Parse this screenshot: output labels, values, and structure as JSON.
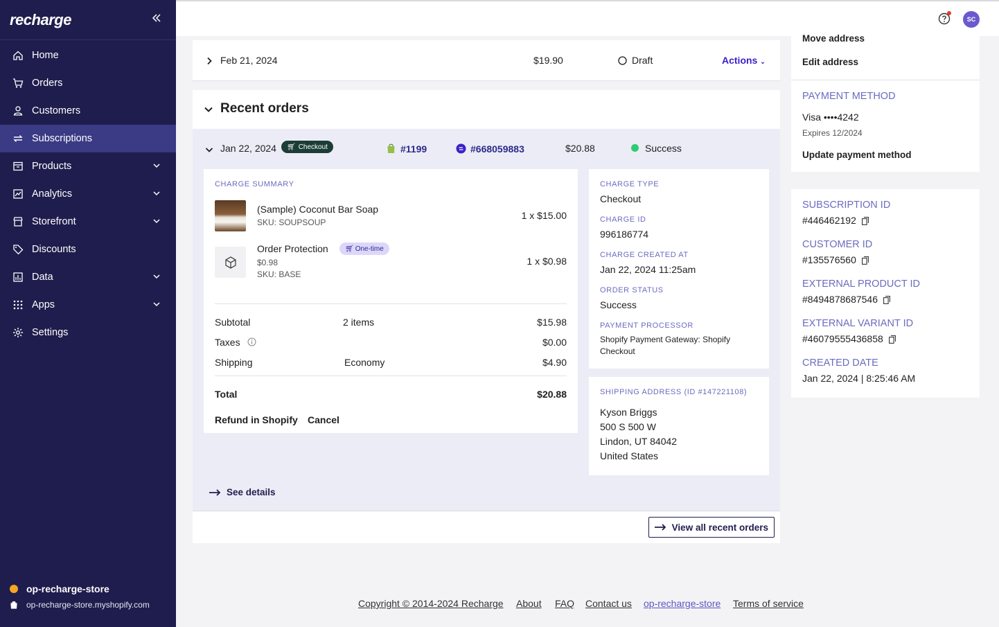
{
  "app": {
    "logo": "recharge"
  },
  "sidebar": {
    "items": [
      {
        "label": "Home",
        "icon": "home-icon"
      },
      {
        "label": "Orders",
        "icon": "cart-icon"
      },
      {
        "label": "Customers",
        "icon": "user-icon"
      },
      {
        "label": "Subscriptions",
        "icon": "repeat-icon",
        "active": true
      },
      {
        "label": "Products",
        "icon": "box-icon",
        "expandable": true
      },
      {
        "label": "Analytics",
        "icon": "chart-icon",
        "expandable": true
      },
      {
        "label": "Storefront",
        "icon": "store-icon",
        "expandable": true
      },
      {
        "label": "Discounts",
        "icon": "tag-icon"
      },
      {
        "label": "Data",
        "icon": "data-icon",
        "expandable": true
      },
      {
        "label": "Apps",
        "icon": "grid-icon",
        "expandable": true
      },
      {
        "label": "Settings",
        "icon": "gear-icon"
      }
    ],
    "store_name": "op-recharge-store",
    "store_url": "op-recharge-store.myshopify.com"
  },
  "topbar": {
    "avatar_initials": "SC"
  },
  "upcoming_charge": {
    "date": "Feb 21, 2024",
    "amount": "$19.90",
    "status": "Draft",
    "actions_label": "Actions"
  },
  "recent_orders": {
    "title": "Recent orders",
    "order": {
      "date": "Jan 22, 2024",
      "badge": "Checkout",
      "shopify_order": "#1199",
      "recharge_order": "#668059883",
      "amount": "$20.88",
      "status": "Success"
    },
    "charge_summary": {
      "label": "CHARGE SUMMARY",
      "items": [
        {
          "name": "(Sample) Coconut Bar Soap",
          "sku": "SKU: SOUPSOUP",
          "qty_price": "1 x $15.00"
        },
        {
          "name": "Order Protection",
          "badge": "One-time",
          "price": "$0.98",
          "sku": "SKU: BASE",
          "qty_price": "1 x $0.98"
        }
      ],
      "subtotal_label": "Subtotal",
      "subtotal_items": "2 items",
      "subtotal": "$15.98",
      "taxes_label": "Taxes",
      "taxes": "$0.00",
      "shipping_label": "Shipping",
      "shipping_method": "Economy",
      "shipping": "$4.90",
      "total_label": "Total",
      "total": "$20.88",
      "refund_label": "Refund in Shopify",
      "cancel_label": "Cancel"
    },
    "charge_details": {
      "charge_type_label": "CHARGE TYPE",
      "charge_type": "Checkout",
      "charge_id_label": "CHARGE ID",
      "charge_id": "996186774",
      "created_label": "CHARGE CREATED AT",
      "created": "Jan 22, 2024 11:25am",
      "order_status_label": "ORDER STATUS",
      "order_status": "Success",
      "processor_label": "PAYMENT PROCESSOR",
      "processor_line1": "Shopify Payment Gateway: Shopify",
      "processor_line2": "Checkout"
    },
    "shipping_address": {
      "label": "SHIPPING ADDRESS (ID #147221108)",
      "name": "Kyson Briggs",
      "line1": "500 S 500 W",
      "line2": "Lindon, UT 84042",
      "country": "United States"
    },
    "see_details": "See details",
    "view_all": "View all recent orders"
  },
  "right_panel": {
    "move_address": "Move address",
    "edit_address": "Edit address",
    "payment_label": "PAYMENT METHOD",
    "card": "Visa ••••4242",
    "expires": "Expires 12/2024",
    "update_payment": "Update payment method",
    "subscription_id_label": "SUBSCRIPTION ID",
    "subscription_id": "#446462192",
    "customer_id_label": "CUSTOMER ID",
    "customer_id": "#135576560",
    "ext_product_label": "EXTERNAL PRODUCT ID",
    "ext_product": "#8494878687546",
    "ext_variant_label": "EXTERNAL VARIANT ID",
    "ext_variant": "#46079555436858",
    "created_label": "CREATED DATE",
    "created": "Jan 22, 2024 | 8:25:46 AM"
  },
  "footer": {
    "copyright": "Copyright © 2014-2024 Recharge",
    "about": "About",
    "faq": "FAQ",
    "contact": "Contact us",
    "store": "op-recharge-store",
    "terms": "Terms of service"
  },
  "colors": {
    "sidebar": "#1f1d4d",
    "active": "#3b3a85",
    "accent": "#2b2a8a",
    "label": "#6b6bc0",
    "success": "#2ecc71"
  }
}
